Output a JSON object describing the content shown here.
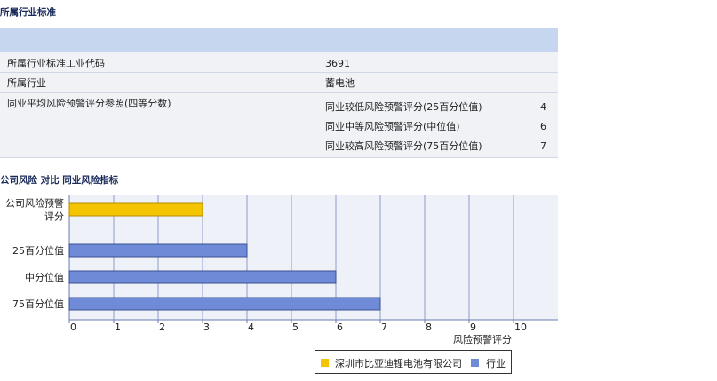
{
  "section1": {
    "title": "所属行业标准"
  },
  "table": {
    "code_label": "所属行业标准工业代码",
    "code_value": "3691",
    "industry_label": "所属行业",
    "industry_value": "蓄电池",
    "avg_label": "同业平均风险预警评分参照(四等分数)",
    "sub_rows": [
      {
        "label": "同业较低风险预警评分(25百分位值)",
        "value": "4"
      },
      {
        "label": "同业中等风险预警评分(中位值)",
        "value": "6"
      },
      {
        "label": "同业较高风险预警评分(75百分位值)",
        "value": "7"
      }
    ]
  },
  "section2": {
    "title": "公司风险 对比 同业风险指标"
  },
  "chart_data": {
    "type": "bar",
    "orientation": "horizontal",
    "categories": [
      "公司风险预警评分",
      "25百分位值",
      "中分位值",
      "75百分位值"
    ],
    "category_label_lines": [
      [
        "公司风险预警",
        "评分"
      ],
      [
        "25百分位值"
      ],
      [
        "中分位值"
      ],
      [
        "75百分位值"
      ]
    ],
    "series": [
      {
        "name": "深圳市比亚迪锂电池有限公司",
        "values": [
          3,
          null,
          null,
          null
        ],
        "color": "#f5c400"
      },
      {
        "name": "行业",
        "values": [
          null,
          4,
          6,
          7
        ],
        "color": "#6f8bd8"
      }
    ],
    "xlabel": "风险预警评分",
    "xlim": [
      0,
      11
    ],
    "xticks": [
      0,
      1,
      2,
      3,
      4,
      5,
      6,
      7,
      8,
      9,
      10
    ],
    "grid": true,
    "legend": "bottom"
  }
}
